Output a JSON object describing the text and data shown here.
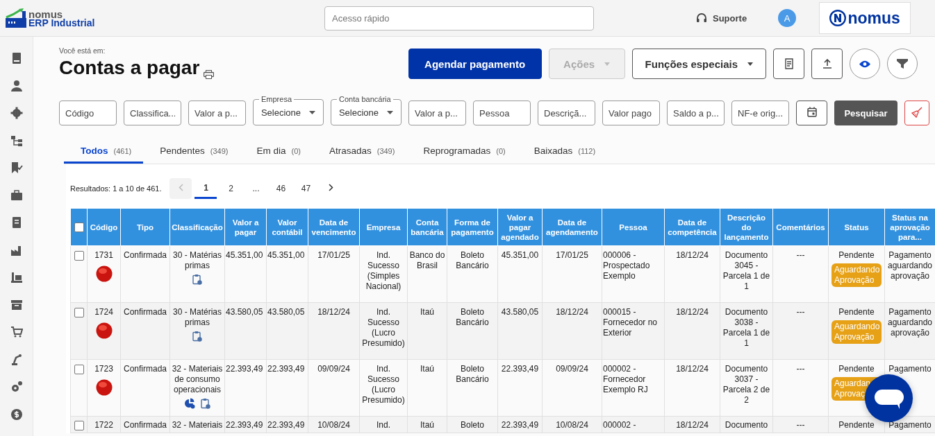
{
  "brand": {
    "name": "nomus",
    "product": "ERP Industrial"
  },
  "topbar": {
    "search_placeholder": "Acesso rápido",
    "support": "Suporte",
    "avatar": "A",
    "partner_logo": "nomus"
  },
  "breadcrumb": "Você está em:",
  "title": "Contas a pagar",
  "actions": [
    {
      "label": "Agendar pagamento",
      "kind": "primary",
      "disabled": false
    },
    {
      "label": "Ações",
      "kind": "dropdown",
      "disabled": true
    },
    {
      "label": "Funções especiais",
      "kind": "dropdown",
      "disabled": false
    },
    {
      "kind": "report"
    },
    {
      "kind": "upload"
    },
    {
      "kind": "eye"
    },
    {
      "kind": "filter"
    }
  ],
  "filters": [
    {
      "kind": "text",
      "placeholder": "Código"
    },
    {
      "kind": "text",
      "placeholder": "Classifica..."
    },
    {
      "kind": "text",
      "placeholder": "Valor a p..."
    },
    {
      "kind": "select",
      "label": "Empresa",
      "value": "Selecione"
    },
    {
      "kind": "select",
      "label": "Conta bancária",
      "value": "Selecione"
    },
    {
      "kind": "text",
      "placeholder": "Valor a p..."
    },
    {
      "kind": "text",
      "placeholder": "Pessoa"
    },
    {
      "kind": "text",
      "placeholder": "Descriçã..."
    },
    {
      "kind": "text",
      "placeholder": "Valor pago"
    },
    {
      "kind": "text",
      "placeholder": "Saldo a p..."
    },
    {
      "kind": "text",
      "placeholder": "NF-e orig..."
    }
  ],
  "search_button": "Pesquisar",
  "tabs": [
    {
      "label": "Todos",
      "count": "(461)",
      "selected": true
    },
    {
      "label": "Pendentes",
      "count": "(349)",
      "selected": false
    },
    {
      "label": "Em dia",
      "count": "(0)",
      "selected": false
    },
    {
      "label": "Atrasadas",
      "count": "(349)",
      "selected": false
    },
    {
      "label": "Reprogramadas",
      "count": "(0)",
      "selected": false
    },
    {
      "label": "Baixadas",
      "count": "(112)",
      "selected": false
    }
  ],
  "results": "Resultados: 1 a 10 de 461.",
  "pagination": {
    "prev_disabled": true,
    "pages": [
      {
        "label": "1",
        "selected": true
      },
      {
        "label": "2",
        "selected": false
      },
      {
        "label": "...",
        "selected": false
      },
      {
        "label": "46",
        "selected": false
      },
      {
        "label": "47",
        "selected": false
      }
    ]
  },
  "table": {
    "select_all_checked": false,
    "columns": [
      "Código",
      "Tipo",
      "Classificação",
      "Valor a pagar",
      "Valor contábil",
      "Data de vencimento",
      "Empresa",
      "Conta bancária",
      "Forma de pagamento",
      "Valor a pagar agendado",
      "Data de agendamento",
      "Pessoa",
      "Data de competência",
      "Descrição do lançamento",
      "Comentários",
      "Status",
      "Status na aprovação para..."
    ],
    "rows": [
      {
        "checked": false,
        "marker": true,
        "code": "1731",
        "tipo": "Confirmada",
        "classificacao": "30 - Matérias primas",
        "icons": [
          {
            "kind": "clipboard"
          }
        ],
        "valor": "45.351,00",
        "contabil": "45.351,00",
        "vencimento": "17/01/25",
        "empresa": "Ind. Sucesso (Simples Nacional)",
        "conta": "Banco do Brasil",
        "forma": "Boleto Bancário",
        "agendado": "45.351,00",
        "agendamento": "17/01/25",
        "pessoa": "000006 - Prospectado Exemplo",
        "competencia": "18/12/24",
        "descricao": "Documento 3045 - Parcela 1 de 1",
        "comentarios": "---",
        "status": "Pendente",
        "badge": "Aguardando Aprovação",
        "aprovacao": "Pagamento aguardando aprovação"
      },
      {
        "checked": false,
        "marker": true,
        "code": "1724",
        "tipo": "Confirmada",
        "classificacao": "30 - Matérias primas",
        "icons": [
          {
            "kind": "clipboard"
          }
        ],
        "valor": "43.580,05",
        "contabil": "43.580,05",
        "vencimento": "18/12/24",
        "empresa": "Ind. Sucesso (Lucro Presumido)",
        "conta": "Itaú",
        "forma": "Boleto Bancário",
        "agendado": "43.580,05",
        "agendamento": "18/12/24",
        "pessoa": "000015 - Fornecedor no Exterior",
        "competencia": "18/12/24",
        "descricao": "Documento 3038 - Parcela 1 de 1",
        "comentarios": "---",
        "status": "Pendente",
        "badge": "Aguardando Aprovação",
        "aprovacao": "Pagamento aguardando aprovação"
      },
      {
        "checked": false,
        "marker": true,
        "code": "1723",
        "tipo": "Confirmada",
        "classificacao": "32 - Materiais de consumo operacionais",
        "icons": [
          {
            "kind": "chart"
          },
          {
            "kind": "clipboard"
          }
        ],
        "valor": "22.393,49",
        "contabil": "22.393,49",
        "vencimento": "09/09/24",
        "empresa": "Ind. Sucesso (Lucro Presumido)",
        "conta": "Itaú",
        "forma": "Boleto Bancário",
        "agendado": "22.393,49",
        "agendamento": "09/09/24",
        "pessoa": "000002 - Fornecedor Exemplo RJ",
        "competencia": "18/12/24",
        "descricao": "Documento 3037 - Parcela 2 de 2",
        "comentarios": "---",
        "status": "Pendente",
        "badge": "Aguardan Aprovaç",
        "aprovacao": "Pagamento"
      },
      {
        "checked": false,
        "marker": false,
        "code": "1722",
        "tipo": "Confirmada",
        "classificacao": "32 - Materiais",
        "icons": [],
        "valor": "22.393,49",
        "contabil": "22.393,49",
        "vencimento": "10/08/24",
        "empresa": "Ind.",
        "conta": "Itaú",
        "forma": "Boleto",
        "agendado": "22.393,49",
        "agendamento": "10/08/24",
        "pessoa": "000002 -",
        "competencia": "18/12/24",
        "descricao": "Documento",
        "comentarios": "---",
        "status": "Pendente",
        "aprovacao": "Pagamento"
      }
    ]
  }
}
